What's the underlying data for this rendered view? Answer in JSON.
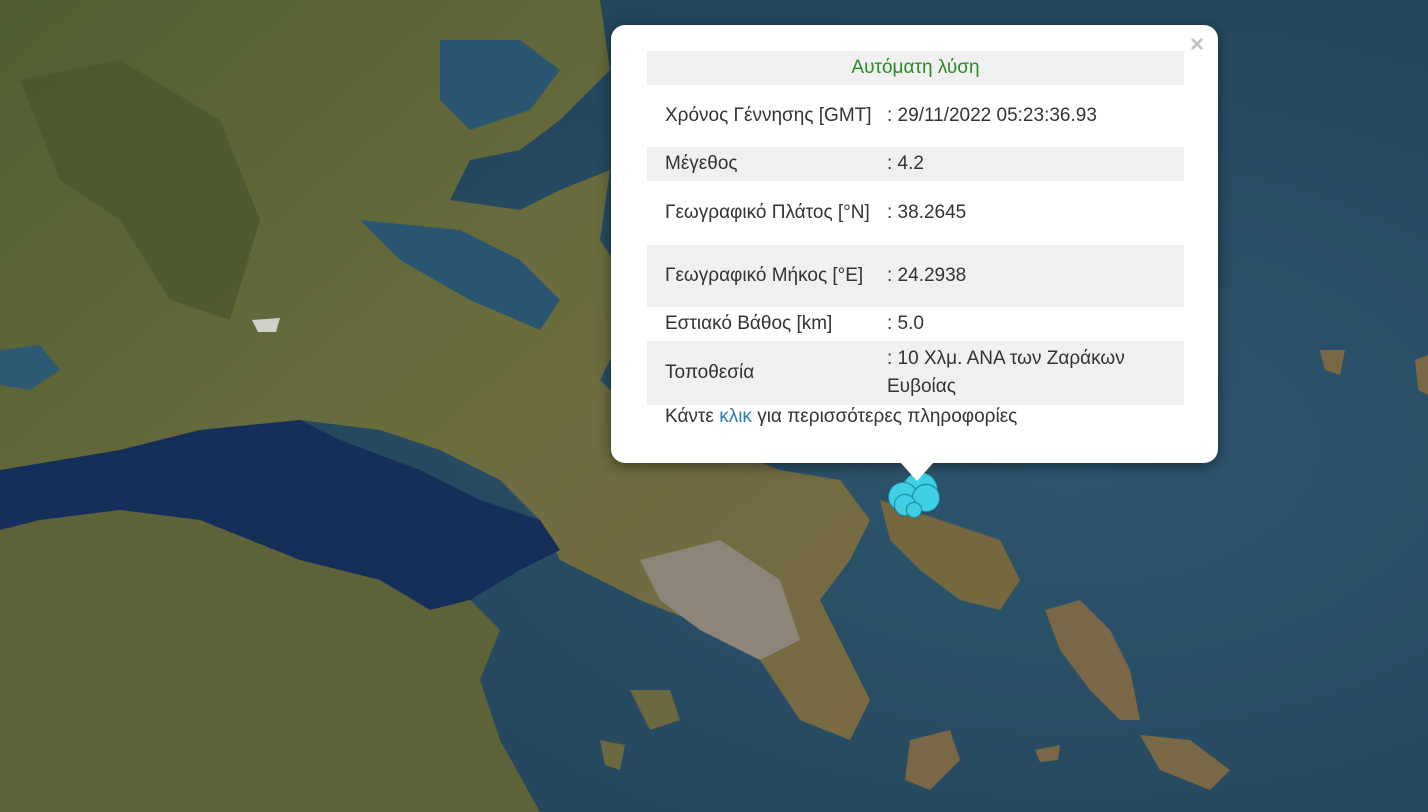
{
  "popup": {
    "title": "Αυτόματη λύση",
    "close_symbol": "×",
    "rows": [
      {
        "label": "Χρόνος Γέννησης [GMT]",
        "value": ": 29/11/2022 05:23:36.93"
      },
      {
        "label": "Μέγεθος",
        "value": ": 4.2"
      },
      {
        "label": "Γεωγραφικό Πλάτος [°N]",
        "value": ": 38.2645"
      },
      {
        "label": "Γεωγραφικό Μήκος [°E]",
        "value": ": 24.2938"
      },
      {
        "label": "Εστιακό Βάθος [km]",
        "value": ": 5.0"
      },
      {
        "label": "Τοποθεσία",
        "value": ": 10 Χλμ. ΑΝΑ των Ζαράκων Ευβοίας"
      }
    ],
    "footer_prefix": "Κάντε",
    "footer_link": "κλικ",
    "footer_suffix": "για περισσότερες πληροφορίες"
  },
  "colors": {
    "sea": "#2a4f66",
    "gulf": "#162f5a",
    "land": "#5e6a3a",
    "marker": "#3fd0e6",
    "title": "#2a8a2a",
    "link": "#2b7fb8"
  },
  "icons": {
    "close": "close-icon",
    "marker": "earthquake-marker-icon"
  }
}
